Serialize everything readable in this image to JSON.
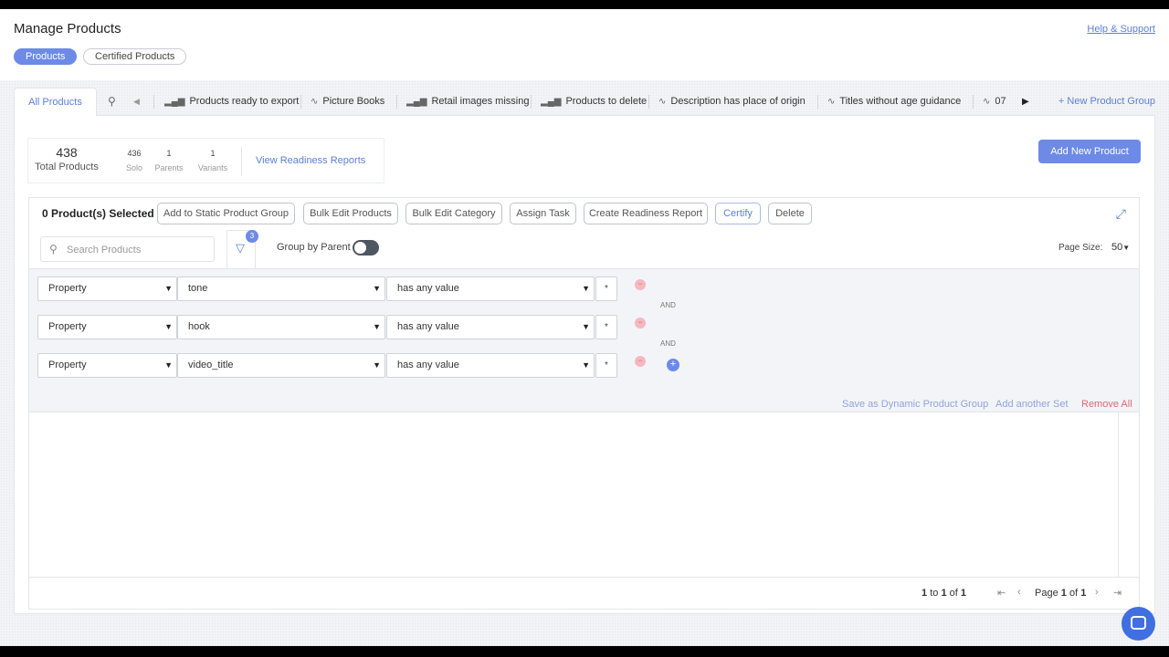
{
  "header": {
    "title": "Manage Products",
    "help_link": "Help & Support",
    "pills": [
      {
        "label": "Products",
        "active": true
      },
      {
        "label": "Certified Products",
        "active": false
      }
    ]
  },
  "tabs": {
    "all_products": "All Products",
    "items": [
      {
        "icon": "bar-chart-icon",
        "label": "Products ready to export"
      },
      {
        "icon": "activity-icon",
        "label": "Picture Books"
      },
      {
        "icon": "bar-chart-icon",
        "label": "Retail images missing"
      },
      {
        "icon": "bar-chart-icon",
        "label": "Products to delete"
      },
      {
        "icon": "activity-icon",
        "label": "Description has place of origin"
      },
      {
        "icon": "activity-icon",
        "label": "Titles without age guidance"
      },
      {
        "icon": "activity-icon",
        "label": "07"
      }
    ],
    "new_group": "+ New Product Group"
  },
  "stats": {
    "total_value": "438",
    "total_label": "Total Products",
    "solo_value": "436",
    "solo_label": "Solo",
    "parents_value": "1",
    "parents_label": "Parents",
    "variants_value": "1",
    "variants_label": "Variants",
    "view_reports": "View Readiness Reports"
  },
  "add_new_product": "Add New Product",
  "toolbar": {
    "selected": "0 Product(s) Selected",
    "buttons": [
      "Add to Static Product Group",
      "Bulk Edit Products",
      "Bulk Edit Category",
      "Assign Task",
      "Create Readiness Report",
      "Certify",
      "Delete"
    ]
  },
  "search": {
    "placeholder": "Search Products"
  },
  "filter_badge": "3",
  "group_by_parent": "Group by Parent",
  "page_size": {
    "label": "Page Size:",
    "value": "50"
  },
  "filters": {
    "rows": [
      {
        "type": "Property",
        "field": "tone",
        "operator": "has any value",
        "value": "*"
      },
      {
        "type": "Property",
        "field": "hook",
        "operator": "has any value",
        "value": "*"
      },
      {
        "type": "Property",
        "field": "video_title",
        "operator": "has any value",
        "value": "*"
      }
    ],
    "and_label": "AND",
    "save_dynamic": "Save as Dynamic Product Group",
    "add_set": "Add another Set",
    "remove_all": "Remove All"
  },
  "pagination": {
    "from": "1",
    "to_word": "to",
    "to": "1",
    "of_word": "of",
    "total": "1",
    "page_word": "Page",
    "page": "1",
    "pages": "1"
  },
  "colors": {
    "accent": "#6d8ae6",
    "link": "#5b7fd6",
    "danger": "#e06775"
  }
}
